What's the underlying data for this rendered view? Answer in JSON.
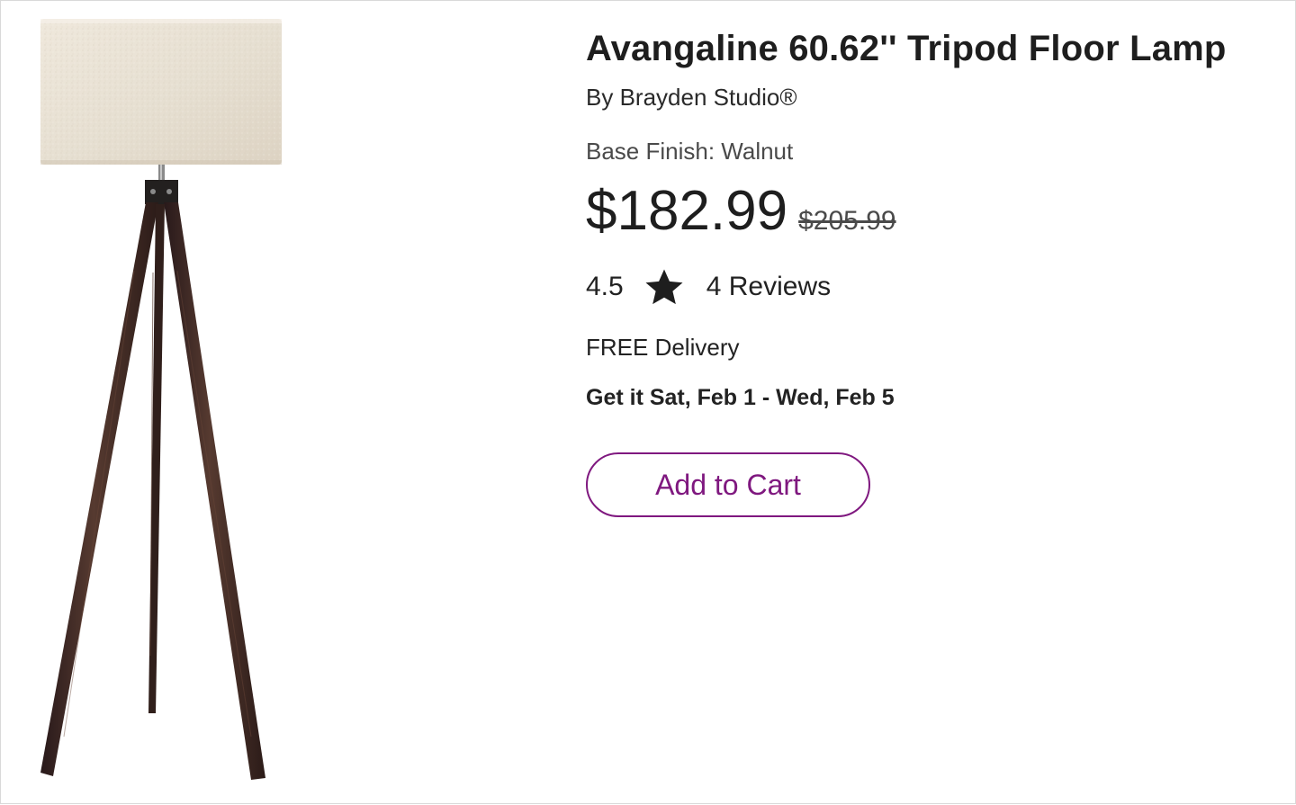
{
  "product": {
    "title": "Avangaline 60.62'' Tripod Floor Lamp",
    "brand": "By Brayden Studio®",
    "base_finish": "Base Finish: Walnut",
    "price": "$182.99",
    "original_price": "$205.99",
    "rating": "4.5",
    "reviews": "4 Reviews",
    "delivery": "FREE Delivery",
    "delivery_date": "Get it Sat, Feb 1 - Wed, Feb 5",
    "add_to_cart": "Add to Cart",
    "image_icon": "tripod-floor-lamp-image",
    "rating_icon": "star-icon"
  },
  "colors": {
    "accent": "#7f187f",
    "text": "#222222",
    "muted_text": "#4a4a4a",
    "lamp_shade": "#e9e3d7",
    "lamp_wood": "#3d2822"
  }
}
